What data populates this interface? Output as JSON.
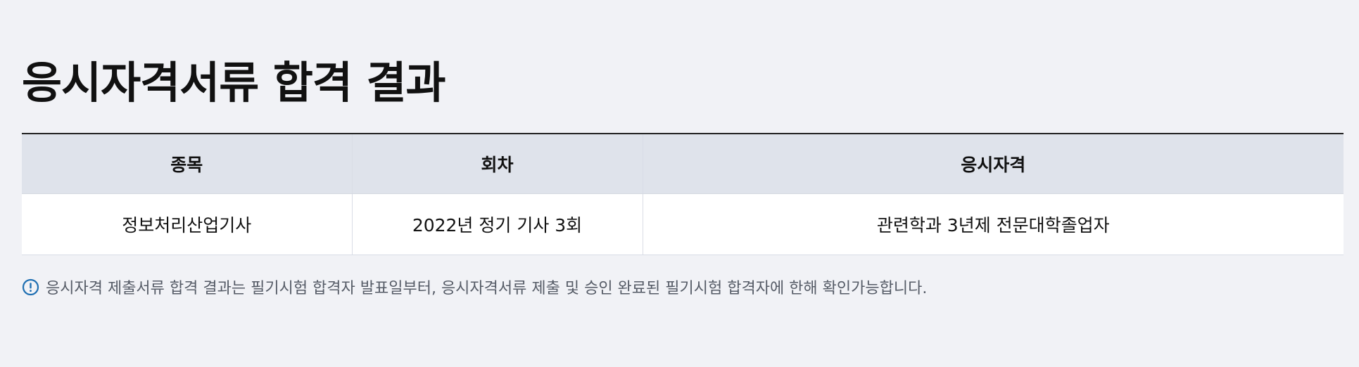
{
  "page": {
    "title": "응시자격서류 합격 결과"
  },
  "table": {
    "headers": [
      "종목",
      "회차",
      "응시자격"
    ],
    "rows": [
      [
        "정보처리산업기사",
        "2022년 정기 기사 3회",
        "관련학과 3년제 전문대학졸업자"
      ]
    ]
  },
  "notice": {
    "icon": "info-icon",
    "text": "응시자격 제출서류 합격 결과는 필기시험 합격자 발표일부터, 응시자격서류 제출 및 승인 완료된 필기시험 합격자에 한해 확인가능합니다."
  },
  "colors": {
    "background": "#f1f2f6",
    "header_bg": "#dfe3eb",
    "notice_icon": "#1f6fb2"
  }
}
